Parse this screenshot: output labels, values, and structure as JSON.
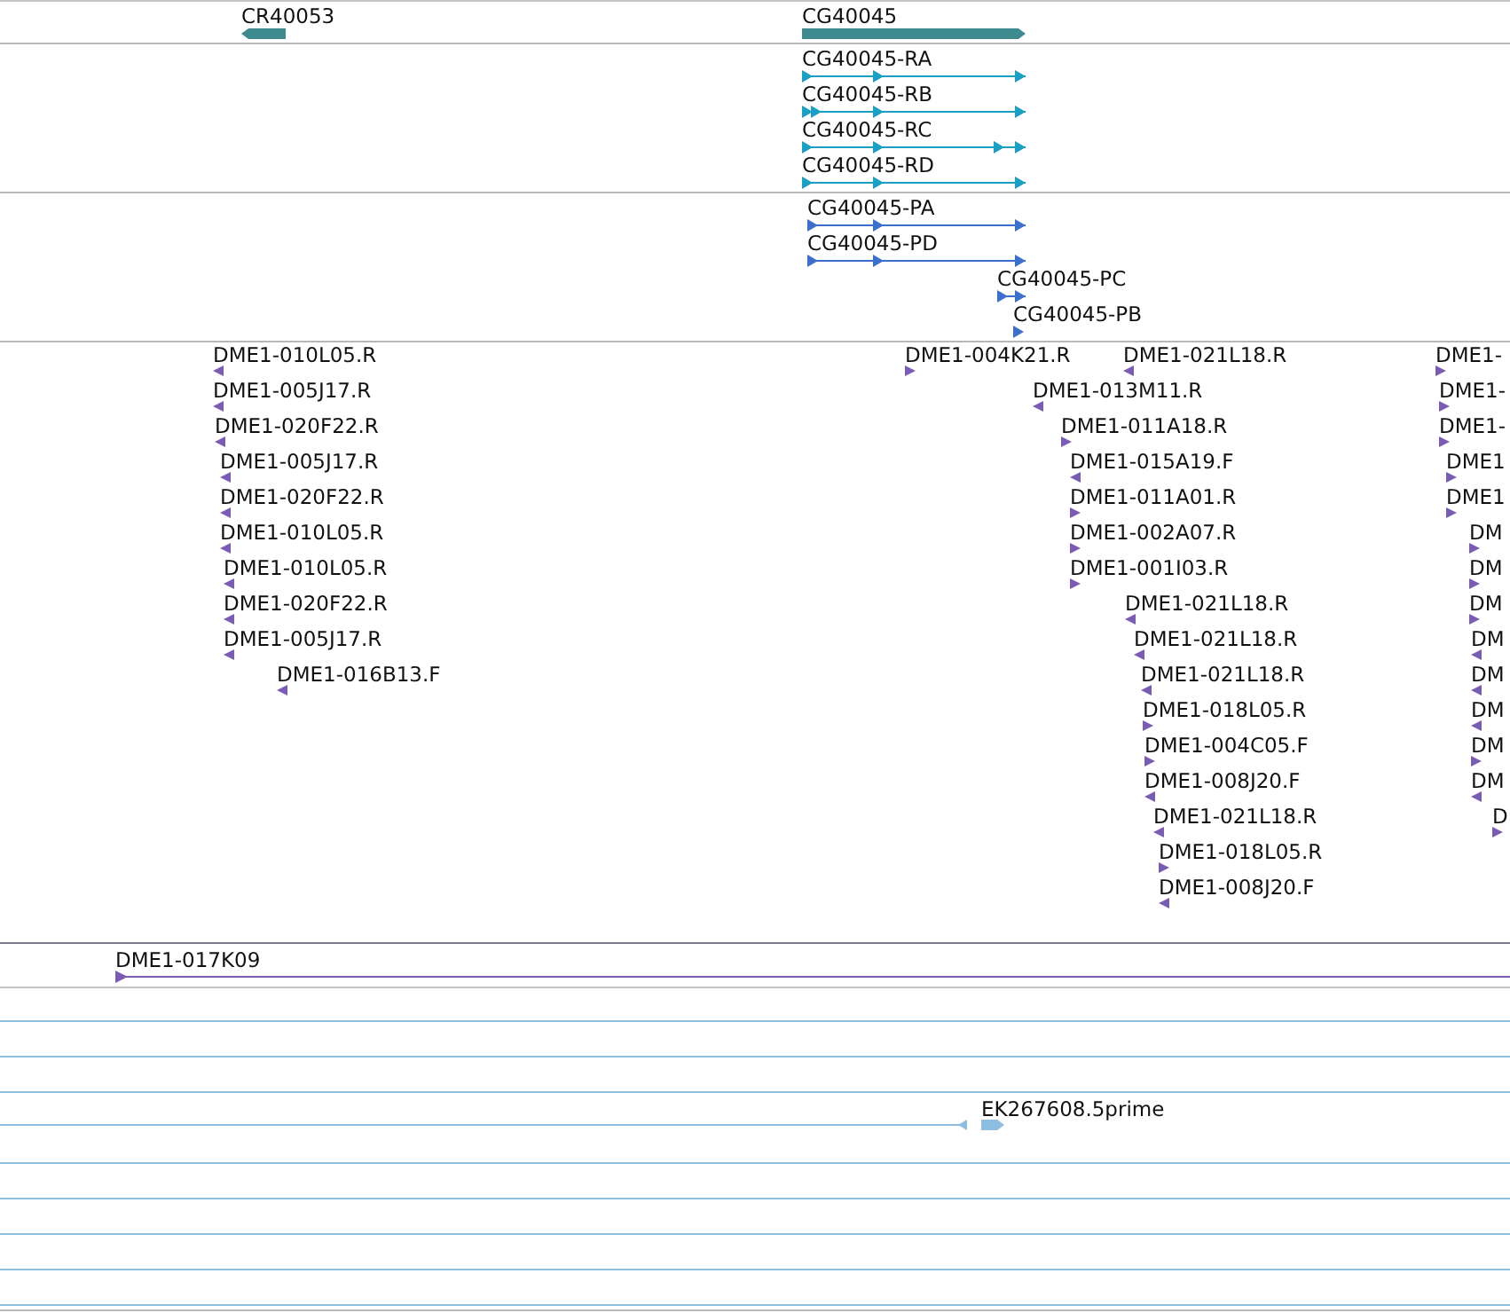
{
  "tracks": [
    {
      "kind": "gene",
      "color": "#3d8a8f",
      "features": [
        {
          "label": "CR40053",
          "reverse": true
        },
        {
          "label": "CG40045",
          "reverse": false
        }
      ]
    },
    {
      "kind": "transcript",
      "color": "#1a9fc4",
      "features": [
        {
          "label": "CG40045-RA",
          "reverse": false
        },
        {
          "label": "CG40045-RB",
          "reverse": false
        },
        {
          "label": "CG40045-RC",
          "reverse": false
        },
        {
          "label": "CG40045-RD",
          "reverse": false
        }
      ]
    },
    {
      "kind": "transcript",
      "color": "#3a6fd0",
      "features": [
        {
          "label": "CG40045-PA",
          "reverse": false
        },
        {
          "label": "CG40045-PD",
          "reverse": false
        },
        {
          "label": "CG40045-PC",
          "reverse": false
        },
        {
          "label": "CG40045-PB",
          "reverse": false
        }
      ]
    },
    {
      "kind": "marker",
      "color": "#7a5cb5",
      "features": [
        {
          "label": "DME1-010L05.R",
          "reverse": true
        },
        {
          "label": "DME1-005J17.R",
          "reverse": true
        },
        {
          "label": "DME1-020F22.R",
          "reverse": true
        },
        {
          "label": "DME1-005J17.R",
          "reverse": true
        },
        {
          "label": "DME1-020F22.R",
          "reverse": true
        },
        {
          "label": "DME1-010L05.R",
          "reverse": true
        },
        {
          "label": "DME1-010L05.R",
          "reverse": true
        },
        {
          "label": "DME1-020F22.R",
          "reverse": true
        },
        {
          "label": "DME1-005J17.R",
          "reverse": true
        },
        {
          "label": "DME1-016B13.F",
          "reverse": true
        },
        {
          "label": "DME1-004K21.R",
          "reverse": false
        },
        {
          "label": "DME1-021L18.R",
          "reverse": true
        },
        {
          "label": "DME1-013M11.R",
          "reverse": true
        },
        {
          "label": "DME1-011A18.R",
          "reverse": false
        },
        {
          "label": "DME1-015A19.F",
          "reverse": true
        },
        {
          "label": "DME1-011A01.R",
          "reverse": false
        },
        {
          "label": "DME1-002A07.R",
          "reverse": false
        },
        {
          "label": "DME1-001I03.R",
          "reverse": false
        },
        {
          "label": "DME1-021L18.R",
          "reverse": true
        },
        {
          "label": "DME1-021L18.R",
          "reverse": true
        },
        {
          "label": "DME1-021L18.R",
          "reverse": true
        },
        {
          "label": "DME1-018L05.R",
          "reverse": false
        },
        {
          "label": "DME1-004C05.F",
          "reverse": false
        },
        {
          "label": "DME1-008J20.F",
          "reverse": true
        },
        {
          "label": "DME1-021L18.R",
          "reverse": true
        },
        {
          "label": "DME1-018L05.R",
          "reverse": false
        },
        {
          "label": "DME1-008J20.F",
          "reverse": true
        },
        {
          "label": "DME1-",
          "reverse": false
        },
        {
          "label": "DME1-",
          "reverse": false
        },
        {
          "label": "DME1-",
          "reverse": false
        },
        {
          "label": "DME1",
          "reverse": false
        },
        {
          "label": "DME1",
          "reverse": false
        },
        {
          "label": "DM",
          "reverse": false
        },
        {
          "label": "DM",
          "reverse": false
        },
        {
          "label": "DM",
          "reverse": false
        },
        {
          "label": "DM",
          "reverse": true
        },
        {
          "label": "DM",
          "reverse": true
        },
        {
          "label": "DM",
          "reverse": true
        },
        {
          "label": "DM",
          "reverse": false
        },
        {
          "label": "DM",
          "reverse": true
        },
        {
          "label": "D",
          "reverse": false
        }
      ]
    },
    {
      "kind": "clone",
      "color": "#7a5cb5",
      "features": [
        {
          "label": "DME1-017K09",
          "reverse": false
        }
      ]
    },
    {
      "kind": "est",
      "color": "#8dbde0",
      "features": [
        {
          "label": "EK267608.5prime",
          "reverse": false
        }
      ]
    }
  ]
}
